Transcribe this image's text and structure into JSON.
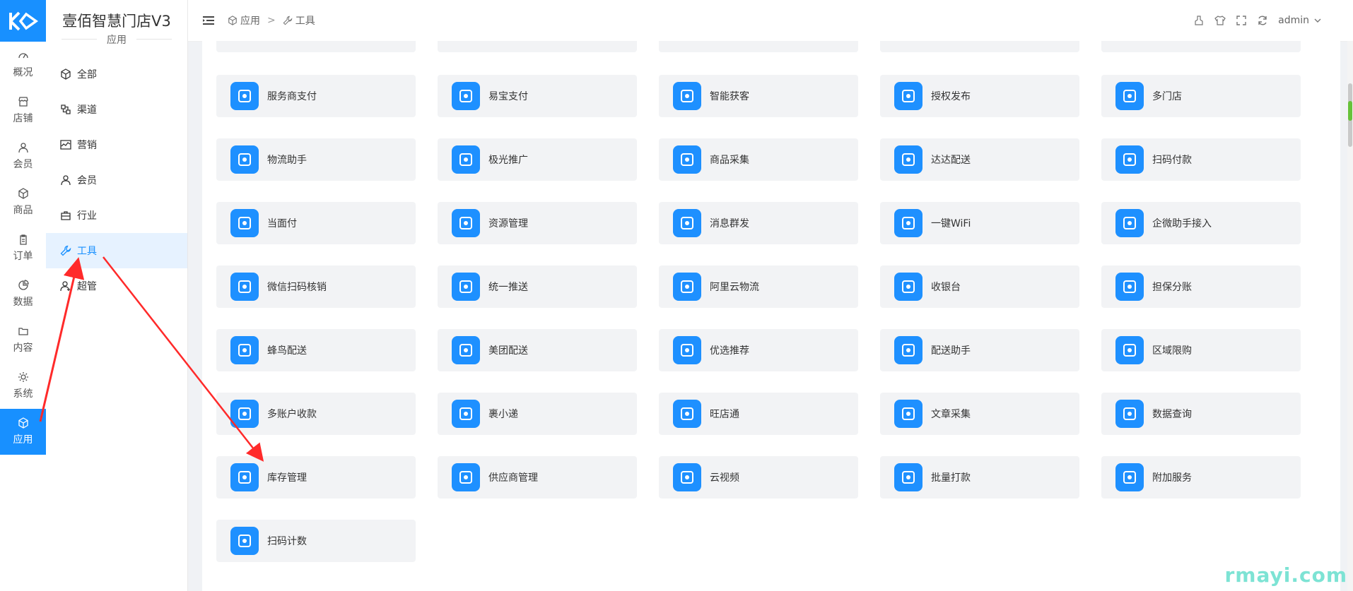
{
  "brand": {
    "title": "壹佰智慧门店V3",
    "section": "应用",
    "color": "#1890ff"
  },
  "iconbar": [
    {
      "label": "概况",
      "icon": "dashboard-icon"
    },
    {
      "label": "店铺",
      "icon": "shop-icon"
    },
    {
      "label": "会员",
      "icon": "user-icon"
    },
    {
      "label": "商品",
      "icon": "box-icon"
    },
    {
      "label": "订单",
      "icon": "clipboard-icon"
    },
    {
      "label": "数据",
      "icon": "pie-icon"
    },
    {
      "label": "内容",
      "icon": "folder-icon"
    },
    {
      "label": "系统",
      "icon": "gear-icon"
    },
    {
      "label": "应用",
      "icon": "cube-icon",
      "active": true
    }
  ],
  "submenu": [
    {
      "label": "全部",
      "icon": "cube-icon"
    },
    {
      "label": "渠道",
      "icon": "channel-icon"
    },
    {
      "label": "营销",
      "icon": "chart-icon"
    },
    {
      "label": "会员",
      "icon": "user-icon"
    },
    {
      "label": "行业",
      "icon": "briefcase-icon"
    },
    {
      "label": "工具",
      "icon": "wrench-icon",
      "active": true
    },
    {
      "label": "超管",
      "icon": "admin-icon"
    }
  ],
  "breadcrumb": {
    "root": "应用",
    "separator": ">",
    "current": "工具"
  },
  "header": {
    "user": "admin"
  },
  "apps": [
    "服务商支付",
    "易宝支付",
    "智能获客",
    "授权发布",
    "多门店",
    "物流助手",
    "极光推广",
    "商品采集",
    "达达配送",
    "扫码付款",
    "当面付",
    "资源管理",
    "消息群发",
    "一键WiFi",
    "企微助手接入",
    "微信扫码核销",
    "统一推送",
    "阿里云物流",
    "收银台",
    "担保分账",
    "蜂鸟配送",
    "美团配送",
    "优选推荐",
    "配送助手",
    "区域限购",
    "多账户收款",
    "裹小递",
    "旺店通",
    "文章采集",
    "数据查询",
    "库存管理",
    "供应商管理",
    "云视频",
    "批量打款",
    "附加服务",
    "扫码计数"
  ],
  "watermark": "rmayi.com",
  "colors": {
    "accent": "#1890ff",
    "card_bg": "#f2f3f5",
    "arrow": "#ff2a2a"
  }
}
